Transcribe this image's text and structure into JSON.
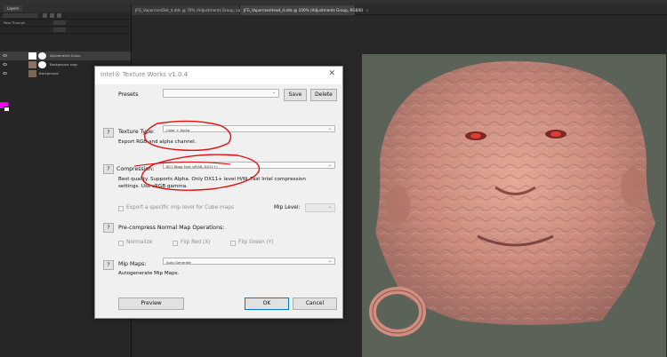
{
  "document_tabs": [
    {
      "label": "JFG_VapormanDet_d.dds @ 70% (Adjustments Group, Layer Mask/8)",
      "active": false
    },
    {
      "label": "JFG_VapormanHead_d.dds @ 100% (Adjustments Group, RGB/8)",
      "active": true
    }
  ],
  "layers_panel": {
    "tab_label": "Layers",
    "blend_mode": "Pass Through",
    "layers": [
      {
        "name": "Adjustments Group",
        "selected": true
      },
      {
        "name": "Background copy",
        "selected": false
      },
      {
        "name": "Background",
        "selected": false
      }
    ],
    "foreground_color": "#f000f0",
    "background_color": "#ffffff"
  },
  "dialog": {
    "title": "Intel® Texture Works v1.0.4",
    "close_icon": "close-icon",
    "presets": {
      "label": "Presets",
      "value": "",
      "save_label": "Save",
      "delete_label": "Delete"
    },
    "help_label": "?",
    "texture_type": {
      "label": "Texture Type:",
      "value": "Color + Alpha",
      "description": "Export RGB and alpha channel."
    },
    "compression": {
      "label": "Compression:",
      "value": "BC7   8bpp  Fast (sRGB, DX11+)",
      "description": "Best quality. Supports Alpha. Only DX11+ level H/W. Fast Intel compression settings. Use sRGB gamma."
    },
    "cube_mip": {
      "checkbox_label": "Export a specific mip level for Cube maps",
      "mip_level_label": "Mip Level:",
      "mip_level_value": ""
    },
    "precompress": {
      "label": "Pre-compress Normal Map Operations:",
      "normalize_label": "Normalize",
      "flip_red_label": "Flip Red (X)",
      "flip_green_label": "Flip Green (Y)"
    },
    "mip_maps": {
      "label": "Mip Maps:",
      "value": "Auto Generate",
      "description": "Autogenerate Mip Maps."
    },
    "preview_label": "Preview",
    "ok_label": "OK",
    "cancel_label": "Cancel"
  },
  "colors": {
    "annotation_red": "#e01010",
    "canvas_bg": "#5b6359"
  }
}
